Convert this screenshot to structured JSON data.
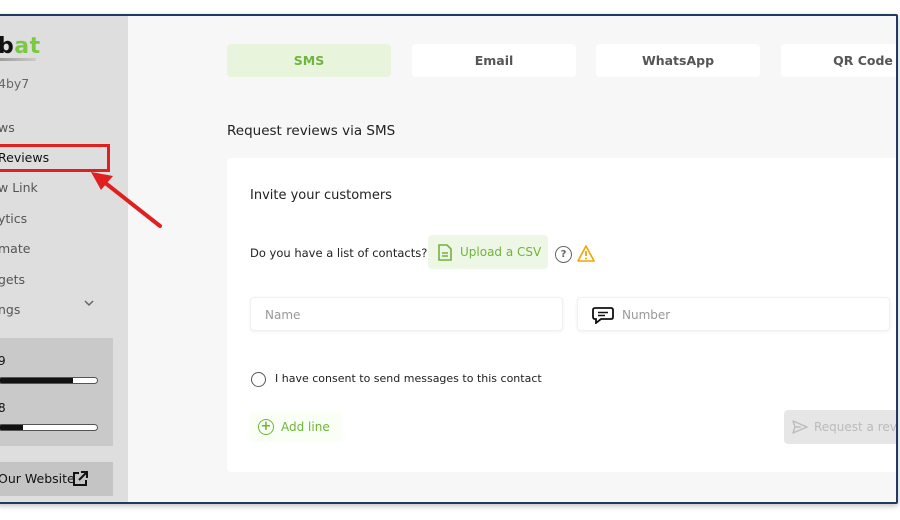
{
  "sidebar": {
    "logo_text": "b",
    "logo_accent": "at",
    "account": "4by7",
    "items": [
      {
        "label": "ws"
      },
      {
        "label": "Reviews"
      },
      {
        "label": "w Link"
      },
      {
        "label": "ytics"
      },
      {
        "label": "mate"
      },
      {
        "label": "gets"
      },
      {
        "label": "ngs"
      }
    ],
    "quota": [
      {
        "value": "9",
        "fill": 0.76
      },
      {
        "value": "8",
        "fill": 0.24
      }
    ],
    "website_label": "Our Website"
  },
  "tabs": [
    {
      "label": "SMS"
    },
    {
      "label": "Email"
    },
    {
      "label": "WhatsApp"
    },
    {
      "label": "QR Code"
    }
  ],
  "main": {
    "section_title": "Request reviews via SMS",
    "card_title": "Invite your customers",
    "csv_question": "Do you have a list of contacts?",
    "upload_label": "Upload a CSV",
    "help_symbol": "?",
    "name_placeholder": "Name",
    "number_placeholder": "Number",
    "consent_label": "I have consent to send messages to this contact",
    "add_line_label": "Add line",
    "add_line_symbol": "+",
    "request_label": "Request a revi"
  },
  "colors": {
    "accent": "#6fb43c",
    "highlight": "#e02020"
  },
  "icons": [
    "external-link-icon",
    "file-icon",
    "help-icon",
    "warning-icon",
    "chat-icon",
    "plus-circle-icon",
    "send-icon",
    "chevron-down-icon"
  ]
}
